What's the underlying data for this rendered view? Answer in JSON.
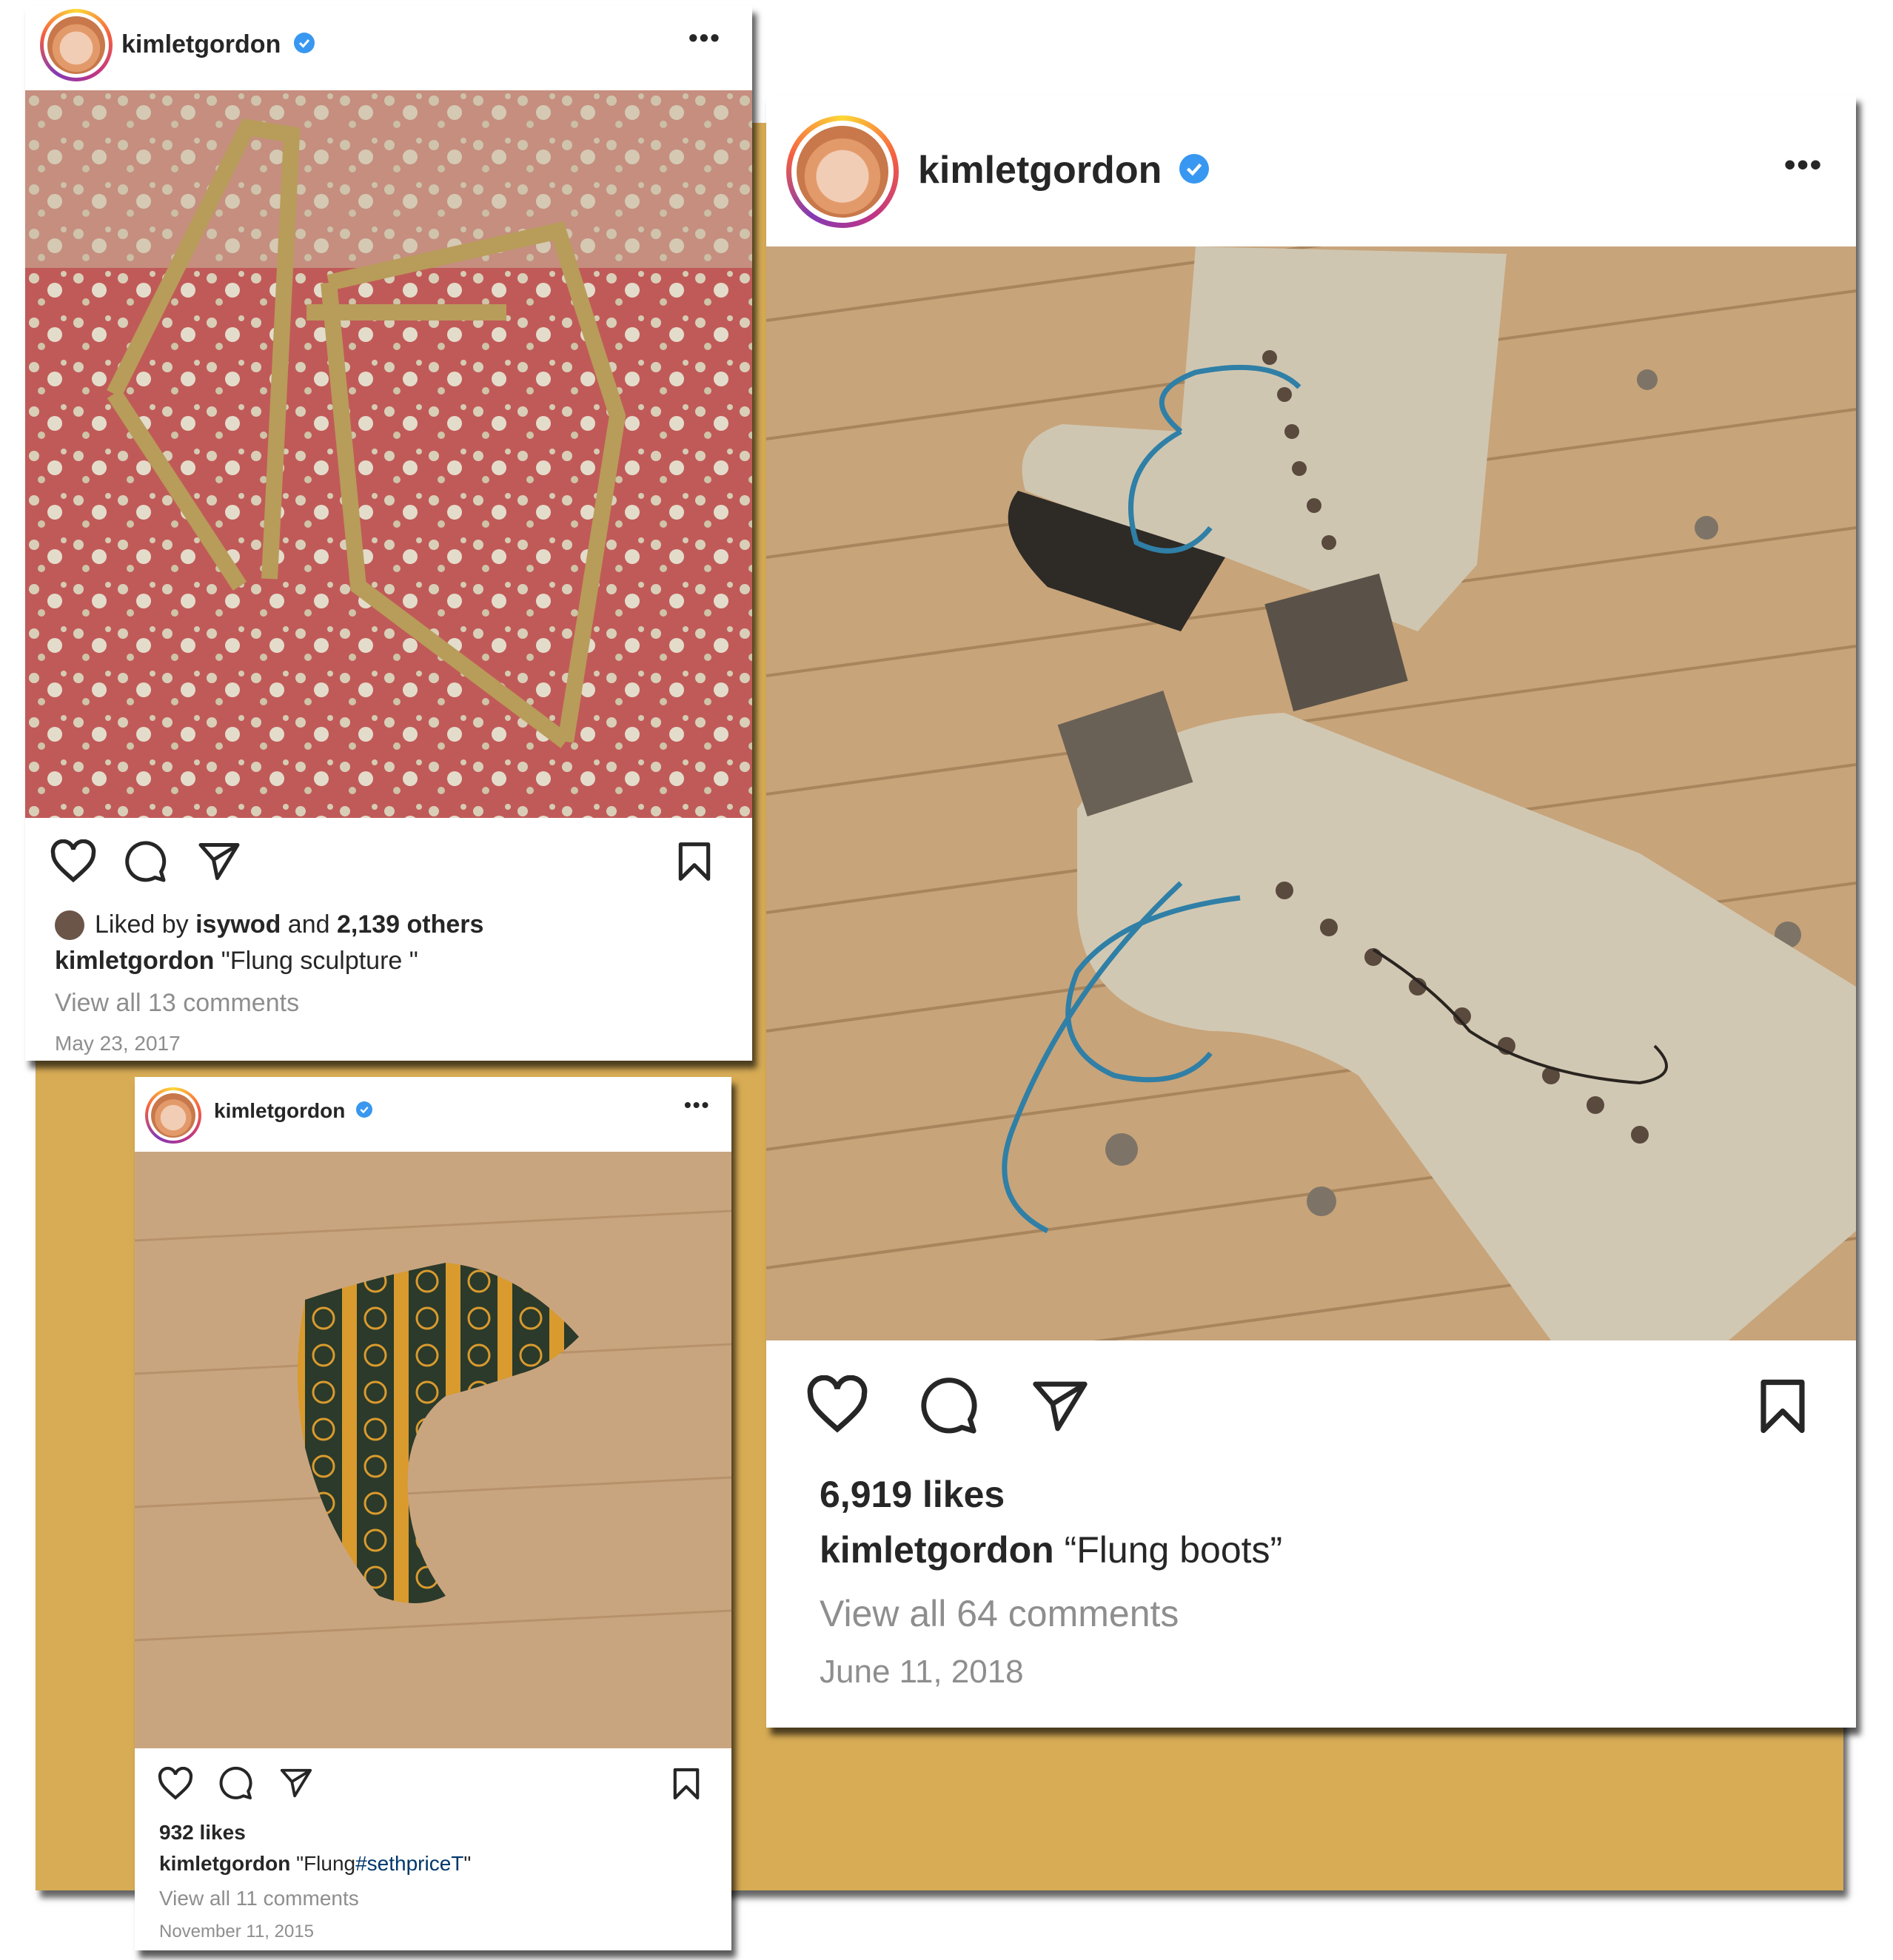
{
  "colors": {
    "backdrop": "#d7ac55",
    "verified_badge": "#3897f0",
    "muted_text": "#8e8e8e",
    "hashtag": "#00376b"
  },
  "post_sculpture": {
    "username": "kimletgordon",
    "more_icon": "more-horizontal-icon",
    "image_alt": "brass sculpture on red painted floor",
    "liked_by_prefix": "Liked by",
    "liked_by_user": "isywod",
    "liked_by_and": "and",
    "liked_by_others": "2,139 others",
    "caption_user": "kimletgordon",
    "caption": "\"Flung sculpture \"",
    "comments": "View all 13 comments",
    "date": "May 23, 2017"
  },
  "post_boots": {
    "username": "kimletgordon",
    "more_icon": "more-horizontal-icon",
    "image_alt": "signed boots on wooden floor",
    "likes": "6,919 likes",
    "caption_user": "kimletgordon",
    "caption": "“Flung boots”",
    "comments": "View all 64 comments",
    "date": "June 11, 2018"
  },
  "post_scarf": {
    "username": "kimletgordon",
    "more_icon": "more-horizontal-icon",
    "image_alt": "FDIC printed fabric on wooden floor",
    "likes": "932 likes",
    "caption_user": "kimletgordon",
    "caption_prefix": "\"Flung",
    "caption_hashtag": "#sethpriceT",
    "caption_suffix": "\"",
    "comments": "View all 11 comments",
    "date": "November 11, 2015"
  }
}
